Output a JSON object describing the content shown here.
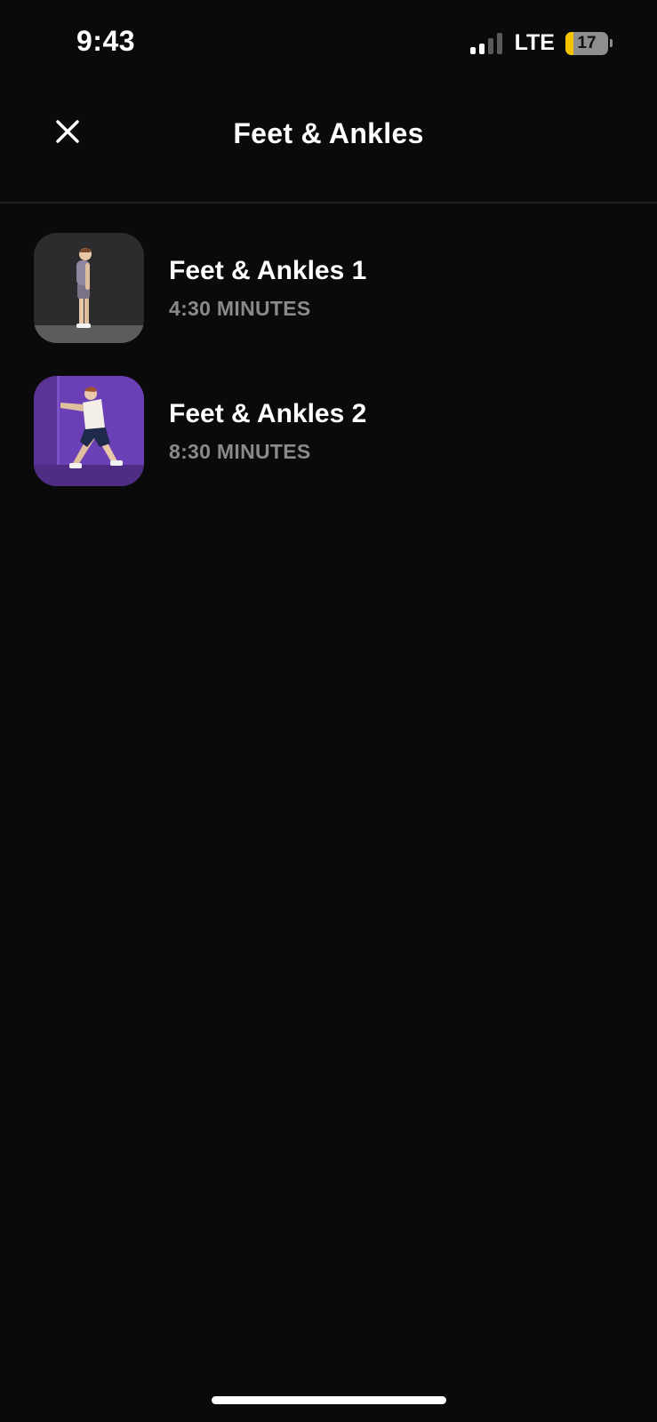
{
  "status_bar": {
    "time": "9:43",
    "network": "LTE",
    "battery_level": "17",
    "battery_color": "#f5c400"
  },
  "header": {
    "title": "Feet & Ankles",
    "close_icon": "close-icon"
  },
  "workouts": [
    {
      "title": "Feet & Ankles 1",
      "duration": "4:30 MINUTES",
      "thumbnail_bg": "#2c2c2e"
    },
    {
      "title": "Feet & Ankles 2",
      "duration": "8:30 MINUTES",
      "thumbnail_bg": "#6b3fb5"
    }
  ]
}
